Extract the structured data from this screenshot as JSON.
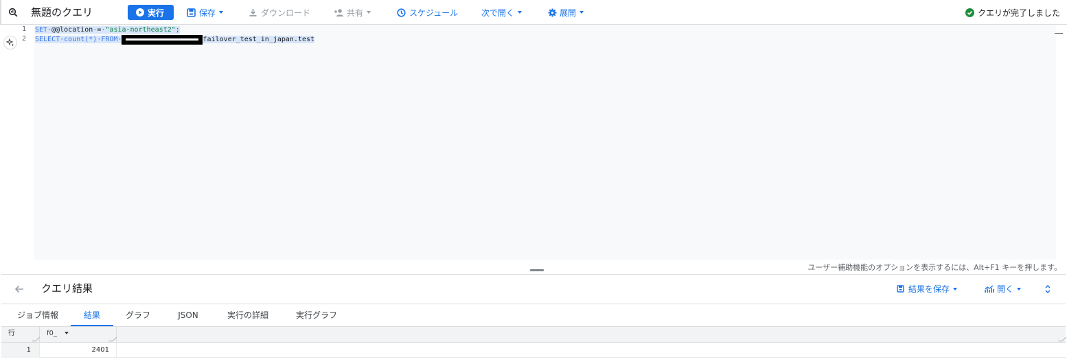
{
  "toolbar": {
    "title": "無題のクエリ",
    "run": "実行",
    "save": "保存",
    "download": "ダウンロード",
    "share": "共有",
    "schedule": "スケジュール",
    "open_in": "次で開く",
    "deploy": "展開",
    "status": "クエリが完了しました"
  },
  "editor": {
    "line_numbers": [
      "1",
      "2"
    ],
    "line1": {
      "kw1": "SET",
      "var": "@@location",
      "op": "=",
      "str": "\"asia-northeast2\";"
    },
    "line2": {
      "kw1": "SELECT",
      "fn": "count(*)",
      "kw2": "FROM",
      "table": "failover_test_in_japan.test"
    },
    "a11y_hint": "ユーザー補助機能のオプションを表示するには、Alt+F1 キーを押します。"
  },
  "results": {
    "title": "クエリ結果",
    "save_results": "結果を保存",
    "open": "開く",
    "tabs": [
      "ジョブ情報",
      "結果",
      "グラフ",
      "JSON",
      "実行の詳細",
      "実行グラフ"
    ],
    "active_tab": "結果",
    "columns": [
      "行",
      "f0_"
    ],
    "rows": [
      {
        "row": "1",
        "f0_": "2401"
      }
    ]
  },
  "colors": {
    "accent": "#1a73e8",
    "success": "#1e8e3e",
    "selection": "#d7e6f9"
  }
}
